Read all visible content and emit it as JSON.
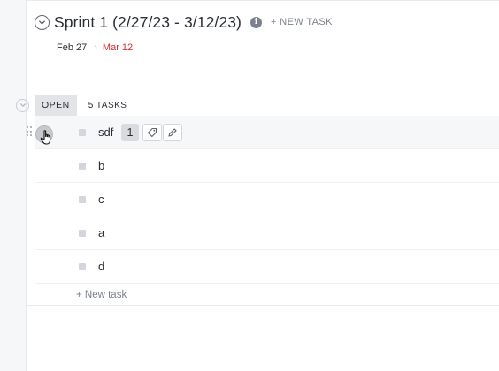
{
  "sprint": {
    "title": "Sprint 1 (2/27/23 - 3/12/23)",
    "new_task_label": "+ NEW TASK",
    "info_icon": "i",
    "start_date": "Feb 27",
    "end_date": "Mar 12",
    "date_separator": "›"
  },
  "group": {
    "status": "OPEN",
    "task_count": "5 TASKS"
  },
  "tasks": [
    {
      "name": "sdf",
      "subtask_count": "1"
    },
    {
      "name": "b"
    },
    {
      "name": "c"
    },
    {
      "name": "a"
    },
    {
      "name": "d"
    }
  ],
  "footer": {
    "new_task_label": "+ New task"
  },
  "colors": {
    "overdue_date": "#d62d2d",
    "status_open_bg": "#e3e4e8",
    "muted_text": "#7c828d"
  }
}
